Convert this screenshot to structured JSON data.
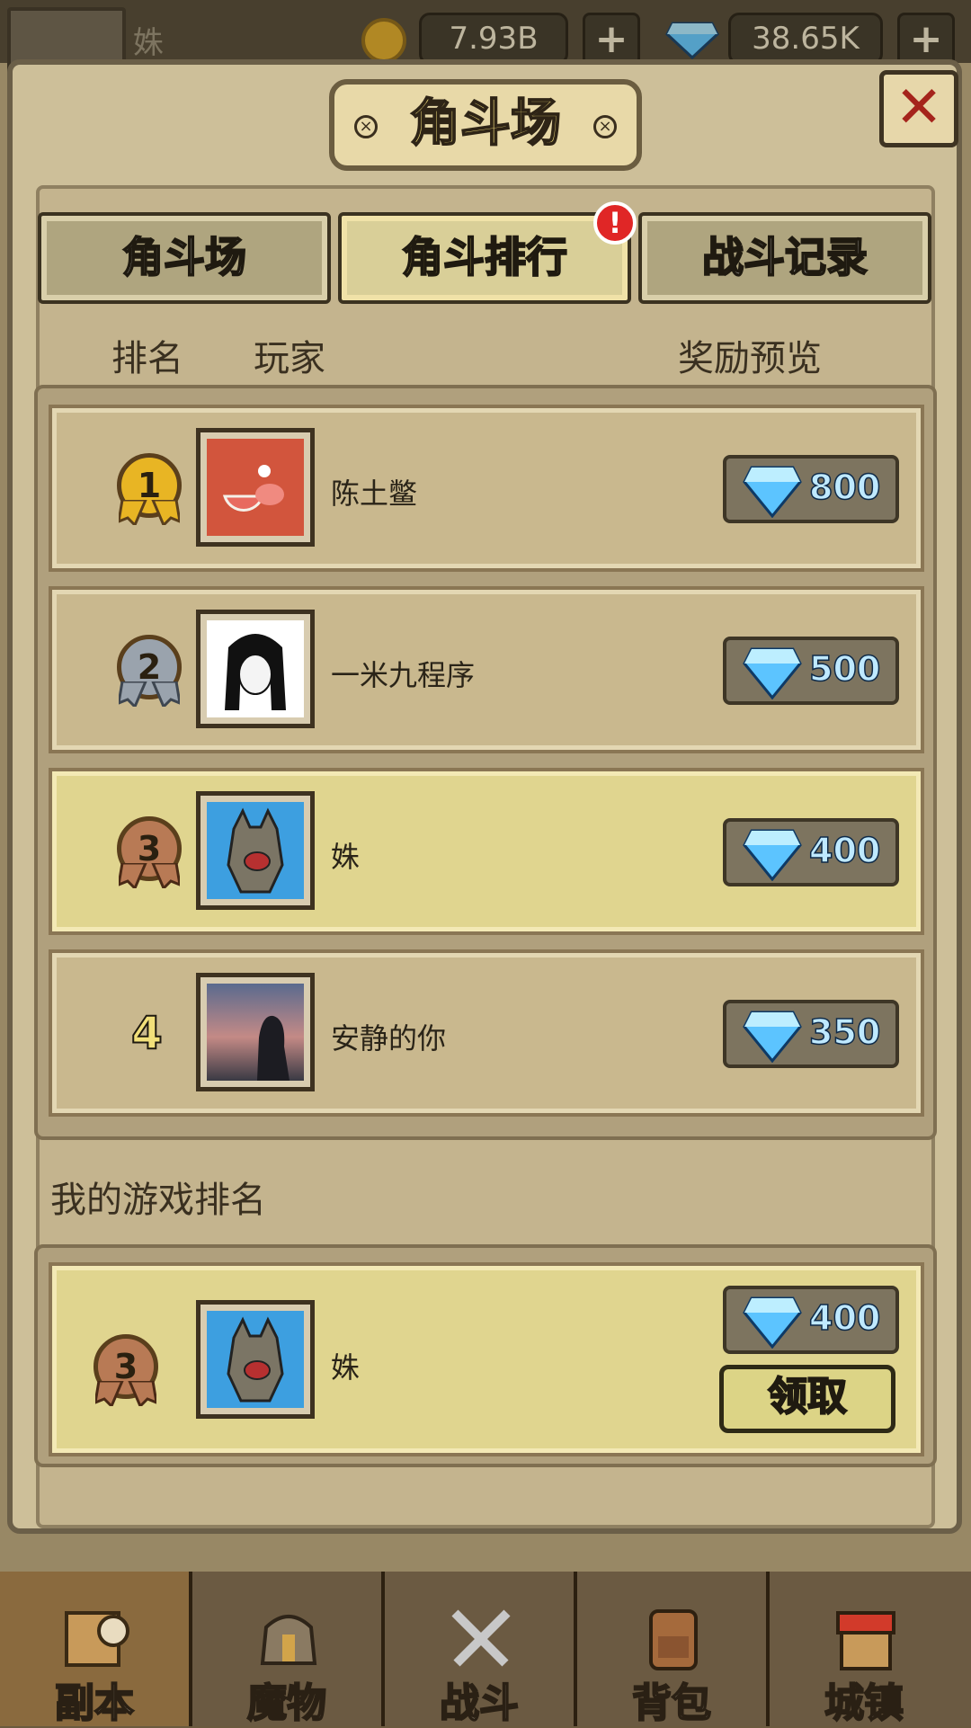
{
  "top_bar": {
    "player_name": "姝",
    "gold": "7.93B",
    "gems": "38.65K",
    "plus_label": "+"
  },
  "modal": {
    "title": "角斗场",
    "close_label": "✕",
    "tabs": [
      {
        "label": "角斗场",
        "active": false
      },
      {
        "label": "角斗排行",
        "active": true,
        "badge": "!"
      },
      {
        "label": "战斗记录",
        "active": false
      }
    ],
    "columns": {
      "rank": "排名",
      "player": "玩家",
      "reward": "奖励预览"
    },
    "rankings": [
      {
        "rank": "1",
        "name": "陈土鳖",
        "reward": "800",
        "medal": "gold",
        "highlight": false
      },
      {
        "rank": "2",
        "name": "一米九程序",
        "reward": "500",
        "medal": "silver",
        "highlight": false
      },
      {
        "rank": "3",
        "name": "姝",
        "reward": "400",
        "medal": "bronze",
        "highlight": true
      },
      {
        "rank": "4",
        "name": "安静的你",
        "reward": "350",
        "medal": "none",
        "highlight": false
      }
    ],
    "my_ranking_label": "我的游戏排名",
    "my_ranking": {
      "rank": "3",
      "name": "姝",
      "reward": "400",
      "claim_label": "领取"
    }
  },
  "bottom_nav": [
    {
      "label": "副本",
      "icon": "map-scroll-icon",
      "active": true
    },
    {
      "label": "魔物",
      "icon": "horned-helmet-icon",
      "active": false
    },
    {
      "label": "战斗",
      "icon": "crossed-swords-icon",
      "active": false
    },
    {
      "label": "背包",
      "icon": "backpack-icon",
      "active": false
    },
    {
      "label": "城镇",
      "icon": "shop-building-icon",
      "active": false
    }
  ],
  "colors": {
    "gold": "#e8b524",
    "silver": "#9aa3ad",
    "bronze": "#b87a55",
    "gem": "#5cc4ff",
    "highlight_row": "#e0d58f"
  }
}
